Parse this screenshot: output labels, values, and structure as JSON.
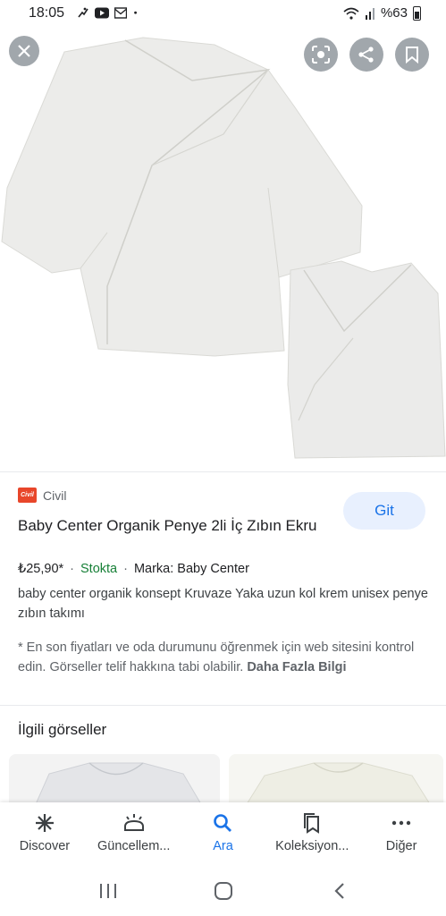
{
  "status_bar": {
    "time": "18:05",
    "battery": "%63"
  },
  "image_viewer": {
    "close_icon": "close-icon",
    "actions": [
      "lens-icon",
      "share-icon",
      "bookmark-icon"
    ]
  },
  "result": {
    "source_logo_text": "Civil",
    "source_name": "Civil",
    "go_label": "Git",
    "title": "Baby Center Organik Penye 2li İç Zıbın Ekru",
    "price": "₺25,90*",
    "stock": "Stokta",
    "brand": "Marka: Baby Center",
    "description": "baby center organik konsept Kruvaze Yaka uzun kol krem unisex penye zıbın takımı",
    "disclaimer": "* En son fiyatları ve oda durumunu öğrenmek için web sitesini kontrol edin. Görseller telif hakkına tabi olabilir.",
    "more_info": "Daha Fazla Bilgi"
  },
  "related": {
    "title": "İlgili görseller"
  },
  "bottom_nav": {
    "items": [
      {
        "label": "Discover",
        "icon": "asterisk-icon"
      },
      {
        "label": "Güncellem...",
        "icon": "updates-icon"
      },
      {
        "label": "Ara",
        "icon": "search-icon"
      },
      {
        "label": "Koleksiyon...",
        "icon": "collections-icon"
      },
      {
        "label": "Diğer",
        "icon": "more-icon"
      }
    ],
    "active_index": 2
  },
  "colors": {
    "accent": "#1a73e8",
    "stock_green": "#188038",
    "source_logo": "#e8462a"
  }
}
